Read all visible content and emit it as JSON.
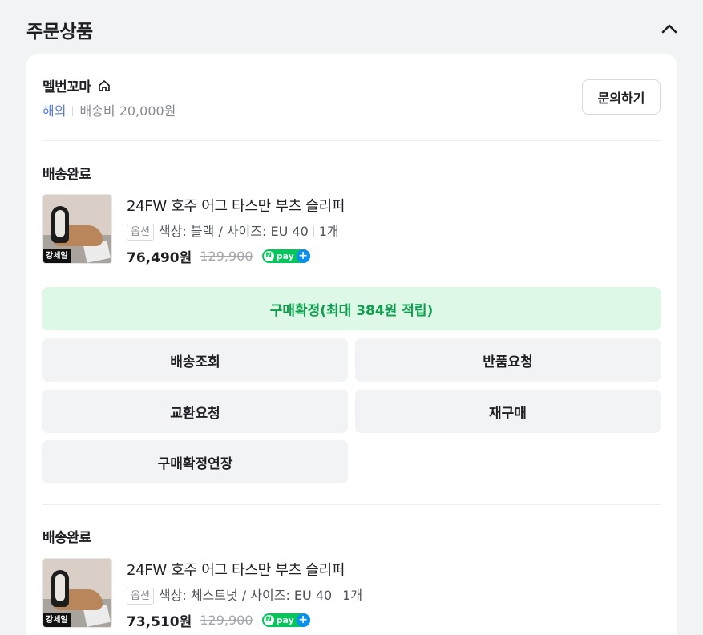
{
  "section": {
    "title": "주문상품"
  },
  "seller": {
    "name": "멜번꼬마",
    "region": "해외",
    "shipping_fee": "배송비 20,000원",
    "inquiry_label": "문의하기"
  },
  "orders": [
    {
      "status": "배송완료",
      "thumb_stamp": "강세일",
      "product_name": "24FW 호주 어그 타스만 부츠 슬리퍼",
      "option_tag": "옵션",
      "option_text": "색상: 블랙 / 사이즈: EU 40",
      "quantity": "1개",
      "price": "76,490원",
      "original_price": "129,900",
      "npay": {
        "n": "N",
        "label": "pay",
        "plus": "+"
      },
      "actions": {
        "confirm": "구매확정(최대 384원 적립)",
        "track": "배송조회",
        "return": "반품요청",
        "exchange": "교환요청",
        "rebuy": "재구매",
        "extend": "구매확정연장"
      }
    },
    {
      "status": "배송완료",
      "thumb_stamp": "강세일",
      "product_name": "24FW 호주 어그 타스만 부츠 슬리퍼",
      "option_tag": "옵션",
      "option_text": "색상: 체스트넛 / 사이즈: EU 40",
      "quantity": "1개",
      "price": "73,510원",
      "original_price": "129,900",
      "npay": {
        "n": "N",
        "label": "pay",
        "plus": "+"
      }
    }
  ],
  "colors": {
    "accent_green": "#0e9f4e",
    "confirm_bg": "#ddf8e6",
    "region_blue": "#5b7cdb",
    "npay_green": "#03c75a"
  },
  "icons": [
    "chevron-up-icon",
    "home-icon",
    "npay-icon"
  ]
}
